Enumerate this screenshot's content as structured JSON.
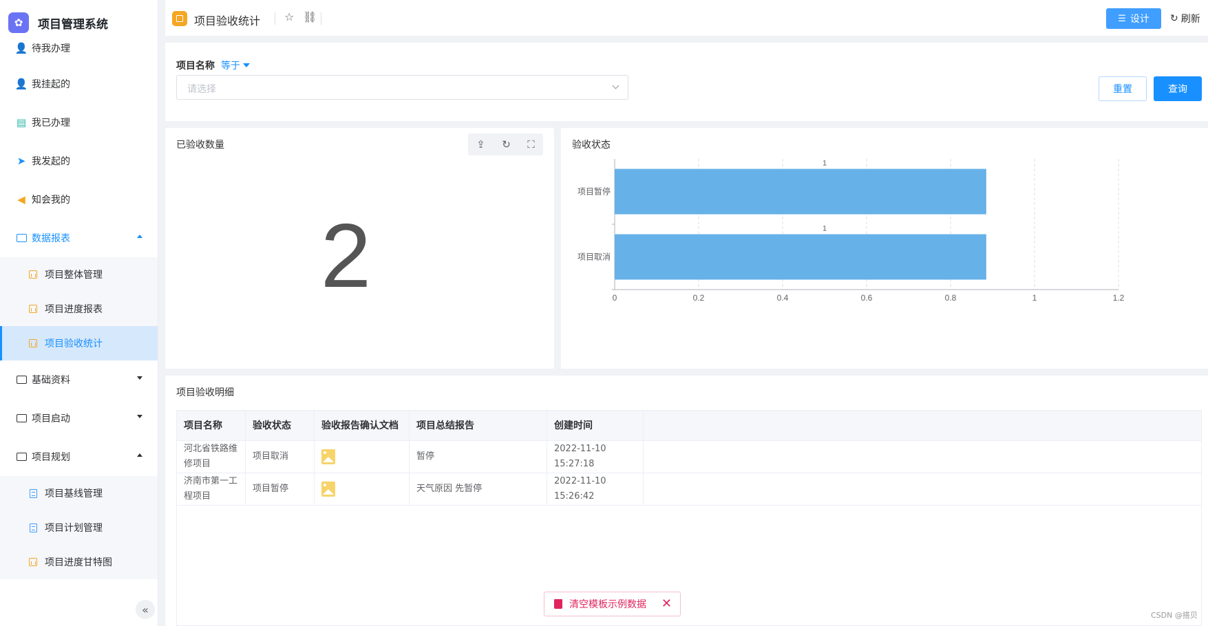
{
  "app": {
    "title": "项目管理系统"
  },
  "sidebar": {
    "items": [
      {
        "label": "待我办理",
        "icon": "user-clock-icon",
        "color": "#1890ff"
      },
      {
        "label": "我挂起的",
        "icon": "user-pause-icon",
        "color": "#1890ff"
      },
      {
        "label": "我已办理",
        "icon": "doc-check-icon",
        "color": "#2ab5a6"
      },
      {
        "label": "我发起的",
        "icon": "send-icon",
        "color": "#1890ff"
      },
      {
        "label": "知会我的",
        "icon": "megaphone-icon",
        "color": "#f5a623"
      }
    ],
    "groups": [
      {
        "label": "数据报表",
        "expanded": true,
        "children": [
          "项目整体管理",
          "项目进度报表",
          "项目验收统计"
        ],
        "selected": "项目验收统计"
      },
      {
        "label": "基础资料",
        "expanded": false
      },
      {
        "label": "项目启动",
        "expanded": false
      },
      {
        "label": "项目规划",
        "expanded": true,
        "children": [
          "项目基线管理",
          "项目计划管理",
          "项目进度甘特图"
        ]
      }
    ]
  },
  "topbar": {
    "page_title": "项目验收统计",
    "design_label": "设计",
    "refresh_label": "刷新"
  },
  "filter": {
    "label": "项目名称",
    "operator": "等于",
    "placeholder": "请选择",
    "reset_label": "重置",
    "query_label": "查询"
  },
  "count_card": {
    "title": "已验收数量",
    "value": "2"
  },
  "status_card": {
    "title": "验收状态"
  },
  "chart_data": {
    "type": "bar",
    "orientation": "horizontal",
    "categories": [
      "项目暂停",
      "项目取消"
    ],
    "values": [
      1,
      1
    ],
    "data_labels": [
      "1",
      "1"
    ],
    "xlim": [
      0,
      1.2
    ],
    "x_ticks": [
      "0",
      "0.2",
      "0.4",
      "0.6",
      "0.8",
      "1",
      "1.2"
    ],
    "grid": true,
    "bar_color": "#66b1e8"
  },
  "detail": {
    "title": "项目验收明细",
    "columns": [
      "项目名称",
      "验收状态",
      "验收报告确认文档",
      "项目总结报告",
      "创建时间"
    ],
    "rows": [
      {
        "name_line1": "河北省铁路维",
        "name_line2": "修项目",
        "status": "项目取消",
        "summary": "暂停",
        "created": "2022-11-10 15:27:18"
      },
      {
        "name_line1": "济南市第一工",
        "name_line2": "程项目",
        "status": "项目暂停",
        "summary": "天气原因  先暂停",
        "created": "2022-11-10 15:26:42"
      }
    ]
  },
  "clear_bar": {
    "label": "清空模板示例数据"
  },
  "footer": {
    "credit": "CSDN @搭贝"
  }
}
